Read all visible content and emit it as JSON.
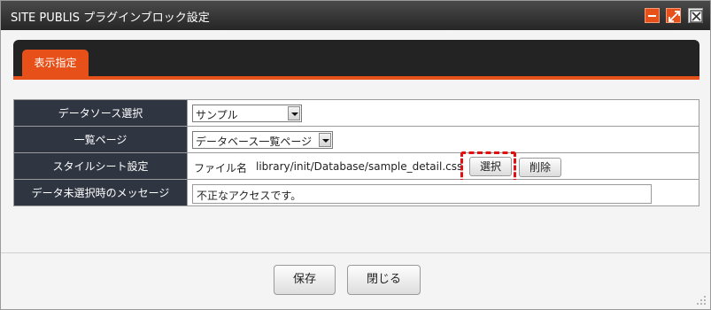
{
  "window": {
    "title": "SITE PUBLIS プラグインブロック設定",
    "controls": [
      "minimize-icon",
      "maximize-icon",
      "close-icon"
    ],
    "accent_color": "#e8501a"
  },
  "tabs": [
    {
      "label": "表示指定",
      "active": true
    }
  ],
  "form": {
    "rows": [
      {
        "label": "データソース選択",
        "type": "select",
        "value": "サンプル"
      },
      {
        "label": "一覧ページ",
        "type": "select",
        "value": "データベース一覧ページ"
      },
      {
        "label": "スタイルシート設定",
        "type": "file",
        "file_label": "ファイル名",
        "file_path": "library/init/Database/sample_detail.css",
        "select_button": "選択",
        "delete_button": "削除"
      },
      {
        "label": "データ未選択時のメッセージ",
        "type": "text",
        "value": "不正なアクセスです。"
      }
    ]
  },
  "footer": {
    "save_label": "保存",
    "close_label": "閉じる"
  }
}
